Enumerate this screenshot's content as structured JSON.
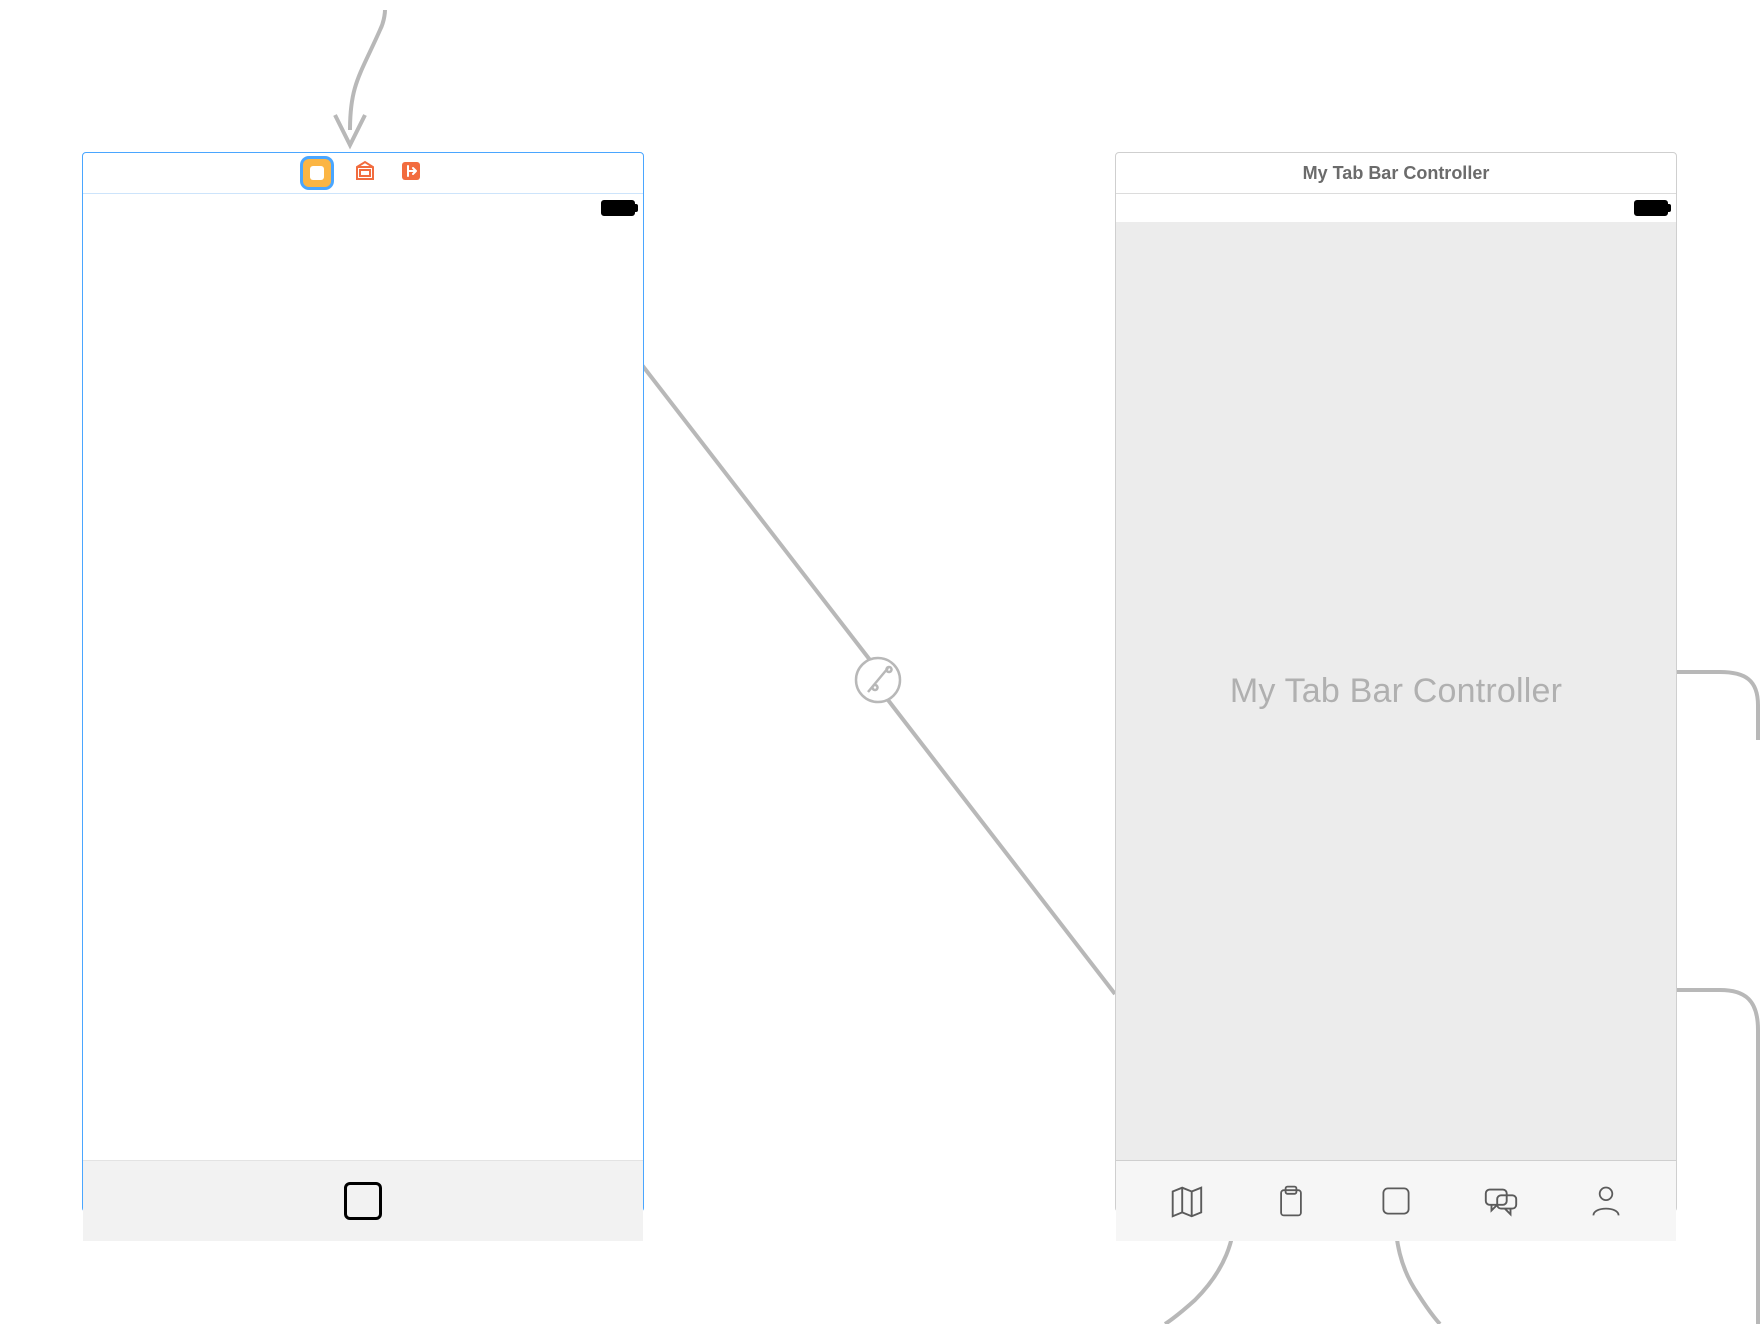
{
  "scene1": {
    "icons": {
      "view_controller": "view-controller-icon",
      "first_responder": "first-responder-icon",
      "exit": "exit-icon"
    }
  },
  "scene2": {
    "title": "My Tab Bar Controller",
    "placeholder": "My Tab Bar Controller",
    "tabs": [
      {
        "icon": "map-icon"
      },
      {
        "icon": "clipboard-icon"
      },
      {
        "icon": "square-icon"
      },
      {
        "icon": "chat-icon"
      },
      {
        "icon": "person-icon"
      }
    ]
  }
}
